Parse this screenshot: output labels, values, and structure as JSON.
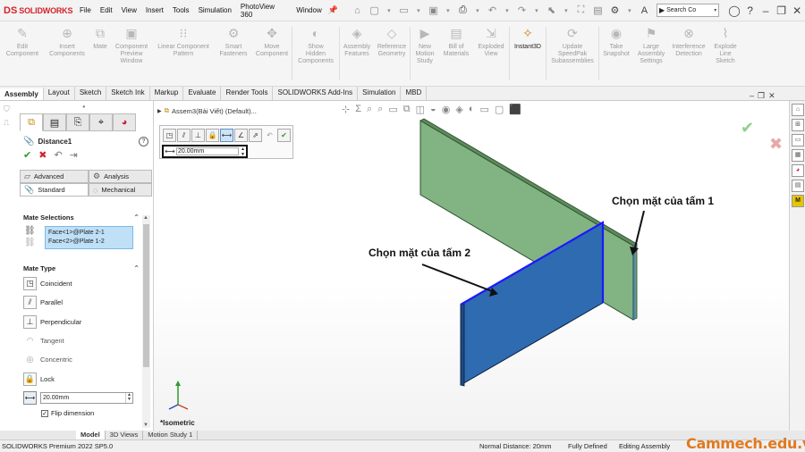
{
  "app": {
    "logo_ds": "DS",
    "logo_name": "SOLIDWORKS"
  },
  "menu": [
    "File",
    "Edit",
    "View",
    "Insert",
    "Tools",
    "Simulation",
    "PhotoView 360",
    "Window"
  ],
  "search": {
    "placeholder": "Search Co"
  },
  "ribbon": [
    {
      "label": "Edit\nComponent",
      "icon": "edit-component-icon",
      "glyph": "✎"
    },
    {
      "label": "Insert\nComponents",
      "icon": "insert-components-icon",
      "glyph": "⊕"
    },
    {
      "label": "Mate",
      "icon": "mate-icon",
      "glyph": "📎"
    },
    {
      "label": "Component\nPreview\nWindow",
      "icon": "preview-window-icon",
      "glyph": "▣"
    },
    {
      "label": "Linear Component\nPattern",
      "icon": "linear-pattern-icon",
      "glyph": "⁝⁝"
    },
    {
      "label": "Smart\nFasteners",
      "icon": "smart-fasteners-icon",
      "glyph": "⚙"
    },
    {
      "label": "Move\nComponent",
      "icon": "move-component-icon",
      "glyph": "✥"
    },
    {
      "label": "Show\nHidden\nComponents",
      "icon": "show-hidden-icon",
      "glyph": "◐"
    },
    {
      "label": "Assembly\nFeatures",
      "icon": "assembly-features-icon",
      "glyph": "◈"
    },
    {
      "label": "Reference\nGeometry",
      "icon": "reference-geometry-icon",
      "glyph": "◇"
    },
    {
      "label": "New\nMotion\nStudy",
      "icon": "motion-study-icon",
      "glyph": "▶"
    },
    {
      "label": "Bill of\nMaterials",
      "icon": "bom-icon",
      "glyph": "▤"
    },
    {
      "label": "Exploded\nView",
      "icon": "exploded-view-icon",
      "glyph": "⇲"
    },
    {
      "label": "Instant3D",
      "icon": "instant3d-icon",
      "glyph": "✧"
    },
    {
      "label": "Update\nSpeedPak\nSubassemblies",
      "icon": "speedpak-icon",
      "glyph": "⟳"
    },
    {
      "label": "Take\nSnapshot",
      "icon": "snapshot-icon",
      "glyph": "◉"
    },
    {
      "label": "Large\nAssembly\nSettings",
      "icon": "large-assembly-icon",
      "glyph": "⚑"
    },
    {
      "label": "Interference\nDetection",
      "icon": "interference-icon",
      "glyph": "⊗"
    },
    {
      "label": "Explode\nLine\nSketch",
      "icon": "explode-line-icon",
      "glyph": "⌇"
    }
  ],
  "tabs": [
    "Assembly",
    "Layout",
    "Sketch",
    "Sketch Ink",
    "Markup",
    "Evaluate",
    "Render Tools",
    "SOLIDWORKS Add-Ins",
    "Simulation",
    "MBD"
  ],
  "property_manager": {
    "title": "Distance1",
    "help": "?",
    "sub_tabs": {
      "advanced": "Advanced",
      "analysis": "Analysis",
      "standard": "Standard",
      "mechanical": "Mechanical"
    },
    "mate_selections_title": "Mate Selections",
    "selections": [
      "Face<1>@Plate 2-1",
      "Face<2>@Plate 1-2"
    ],
    "mate_type_title": "Mate Type",
    "mate_types": [
      "Coincident",
      "Parallel",
      "Perpendicular",
      "Tangent",
      "Concentric",
      "Lock"
    ],
    "distance_value": "20.00mm",
    "flip_label": "Flip dimension"
  },
  "graphics": {
    "tree_title": "Assem3(Bài Viết) (Default)...",
    "popup_distance": "20.00mm",
    "view_label": "*Isometric",
    "annotation_plate1": "Chọn mặt của tấm 1",
    "annotation_plate2": "Chọn mặt của tấm 2",
    "colors": {
      "plate1": "#7fb07f",
      "plate2": "#2f6bb0",
      "highlight": "#1a1aff"
    }
  },
  "model_tabs": [
    "Model",
    "3D Views",
    "Motion Study 1"
  ],
  "status": {
    "version": "SOLIDWORKS Premium 2022 SP5.0",
    "normal_distance": "Normal Distance: 20mm",
    "defined": "Fully Defined",
    "mode": "Editing Assembly"
  },
  "watermark": "Cammech.edu.vn"
}
